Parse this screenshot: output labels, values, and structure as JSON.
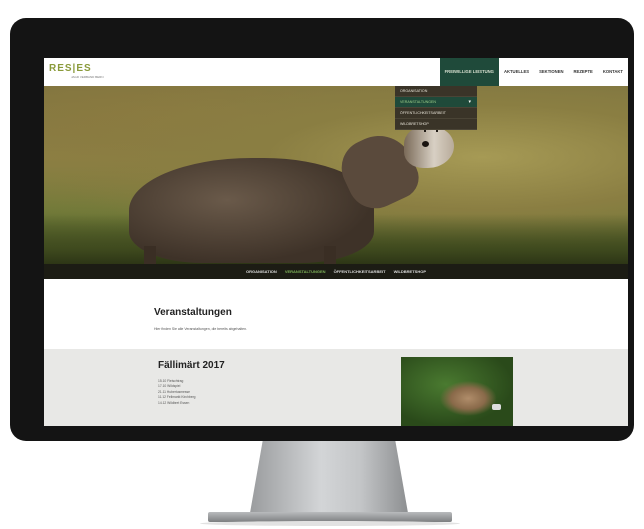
{
  "site": {
    "logo": "RES|ES",
    "logo_sub": "JAGD VERBAND BERN"
  },
  "nav": {
    "items": [
      {
        "label": "Freiwillige Leistung",
        "active": true
      },
      {
        "label": "Aktuelles",
        "active": false
      },
      {
        "label": "Sektionen",
        "active": false
      },
      {
        "label": "Rezepte",
        "active": false
      },
      {
        "label": "Kontakt",
        "active": false
      }
    ]
  },
  "dropdown": {
    "items": [
      {
        "label": "Organisation",
        "active": false
      },
      {
        "label": "Veranstaltungen",
        "active": true
      },
      {
        "label": "Öffentlichkeitsarbeit",
        "active": false
      },
      {
        "label": "Wildbretshop",
        "active": false
      }
    ]
  },
  "subnav": {
    "items": [
      {
        "label": "Organisation",
        "active": false
      },
      {
        "label": "Veranstaltungen",
        "active": true
      },
      {
        "label": "Öffentlichkeitsarbeit",
        "active": false
      },
      {
        "label": "Wildbretshop",
        "active": false
      }
    ]
  },
  "page": {
    "title": "Veranstaltungen",
    "intro": "Hier finden Sie alle Veranstaltungen, die bereits abgehalten."
  },
  "event": {
    "title": "Fällimärt 2017",
    "lines": [
      "15.10 Fleischtrag",
      "17.10 Wildspiel",
      "21.11 Hubertusmesse",
      "11.12 Fellmarkt Kirchberg",
      "14.12 Wildbret Essen"
    ]
  },
  "colors": {
    "accent": "#1f4a3a",
    "active_text": "#7fb35a",
    "subnav_bg": "#1c1c14"
  }
}
